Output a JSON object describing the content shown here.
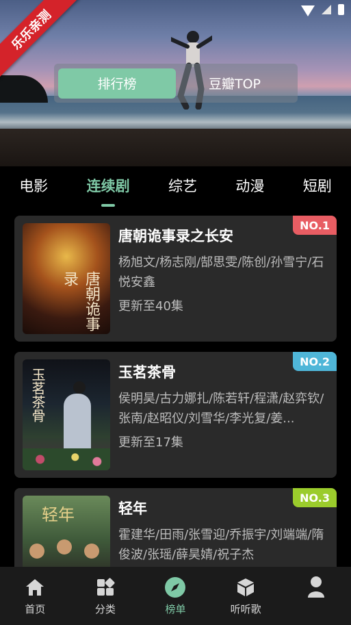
{
  "banner": {
    "ribbon_text": "乐乐亲测",
    "segments": [
      {
        "label": "排行榜",
        "active": true
      },
      {
        "label": "豆瓣TOP",
        "active": false
      }
    ]
  },
  "category_tabs": [
    {
      "label": "电影",
      "active": false
    },
    {
      "label": "连续剧",
      "active": true
    },
    {
      "label": "综艺",
      "active": false
    },
    {
      "label": "动漫",
      "active": false
    },
    {
      "label": "短剧",
      "active": false
    }
  ],
  "shows": [
    {
      "rank": "NO.1",
      "rank_color": "#e85d63",
      "title": "唐朝诡事录之长安",
      "cast": "杨旭文/杨志刚/郜思雯/陈创/孙雪宁/石悦安鑫",
      "update": "更新至40集",
      "poster_text": "唐朝诡事录"
    },
    {
      "rank": "NO.2",
      "rank_color": "#4fb6d8",
      "title": "玉茗茶骨",
      "cast": "侯明昊/古力娜扎/陈若轩/程潇/赵弈钦/张南/赵昭仪/刘雪华/李光复/姜...",
      "update": "更新至17集",
      "poster_text": "玉茗茶骨"
    },
    {
      "rank": "NO.3",
      "rank_color": "#9bcc2c",
      "title": "轻年",
      "cast": "霍建华/田雨/张雪迎/乔振宇/刘端端/隋俊波/张瑶/薛昊婧/祝子杰",
      "update": "",
      "poster_text": "轻年"
    }
  ],
  "bottom_nav": [
    {
      "label": "首页",
      "icon": "home-icon",
      "active": false
    },
    {
      "label": "分类",
      "icon": "grid-icon",
      "active": false
    },
    {
      "label": "榜单",
      "icon": "compass-icon",
      "active": true
    },
    {
      "label": "听听歌",
      "icon": "cube-icon",
      "active": false
    },
    {
      "label": "",
      "icon": "user-icon",
      "active": false
    }
  ],
  "colors": {
    "accent": "#7fc9a6",
    "card": "#2a2a2a"
  }
}
